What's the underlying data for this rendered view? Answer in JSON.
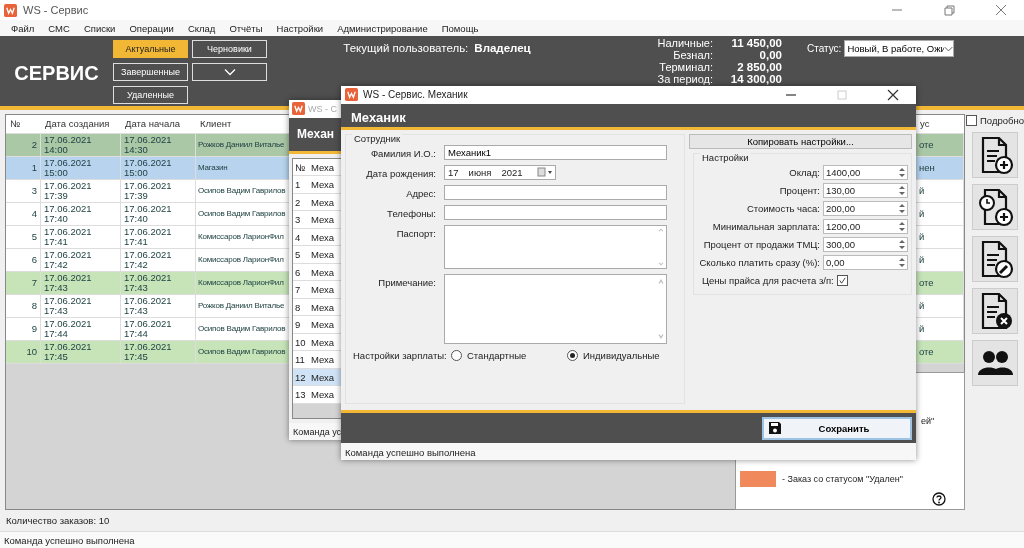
{
  "window": {
    "title": "WS - Сервис"
  },
  "menu": [
    "Файл",
    "СМС",
    "Списки",
    "Операции",
    "Склад",
    "Отчёты",
    "Настройки",
    "Администрирование",
    "Помощь"
  ],
  "header": {
    "title": "СЕРВИС",
    "filters": [
      {
        "kind": "button",
        "label": "Актуальные",
        "selected": true
      },
      {
        "kind": "button",
        "label": "Черновики",
        "selected": false
      },
      {
        "kind": "button",
        "label": "Завершенные",
        "selected": false
      },
      {
        "kind": "dropdown",
        "selected": false
      },
      {
        "kind": "button",
        "label": "Удаленные",
        "selected": false
      }
    ],
    "user_label": "Текущий пользователь:",
    "user": "Владелец",
    "totals": [
      {
        "label": "Наличные:",
        "value": "11 450,00"
      },
      {
        "label": "Безнал:",
        "value": "0,00"
      },
      {
        "label": "Терминал:",
        "value": "2 850,00"
      },
      {
        "label": "За период:",
        "value": "14 300,00"
      }
    ],
    "status_filter": {
      "label": "Статус:",
      "value": "Новый, В работе, Ожи"
    }
  },
  "orders": {
    "columns": [
      "№",
      "Дата создания",
      "Дата начала",
      "Клиент",
      "ус"
    ],
    "rows": [
      {
        "no": "2",
        "created_date": "17.06.2021",
        "created_time": "14:00",
        "start_date": "17.06.2021",
        "start_time": "14:30",
        "client": "Рожков Даниил Виталье",
        "status": "оте",
        "color": "#aac7a6"
      },
      {
        "no": "1",
        "created_date": "17.06.2021",
        "created_time": "15:00",
        "start_date": "17.06.2021",
        "start_time": "15:00",
        "client": "Магазин",
        "status": "нен",
        "color": "#b7d3ee"
      },
      {
        "no": "3",
        "created_date": "17.06.2021",
        "created_time": "17:39",
        "start_date": "17.06.2021",
        "start_time": "17:39",
        "client": "Осипов Вадим Гаврилов",
        "status": "й",
        "color": "#ffffff"
      },
      {
        "no": "4",
        "created_date": "17.06.2021",
        "created_time": "17:40",
        "start_date": "17.06.2021",
        "start_time": "17:40",
        "client": "Осипов Вадим Гаврилов",
        "status": "й",
        "color": "#ffffff"
      },
      {
        "no": "5",
        "created_date": "17.06.2021",
        "created_time": "17:41",
        "start_date": "17.06.2021",
        "start_time": "17:41",
        "client": "Комиссаров ЛарионФил",
        "status": "й",
        "color": "#ffffff"
      },
      {
        "no": "6",
        "created_date": "17.06.2021",
        "created_time": "17:42",
        "start_date": "17.06.2021",
        "start_time": "17:42",
        "client": "Комиссаров ЛарионФил",
        "status": "й",
        "color": "#ffffff"
      },
      {
        "no": "7",
        "created_date": "17.06.2021",
        "created_time": "17:43",
        "start_date": "17.06.2021",
        "start_time": "17:43",
        "client": "Комиссаров ЛарионФил",
        "status": "оте",
        "color": "#c6e4b8"
      },
      {
        "no": "8",
        "created_date": "17.06.2021",
        "created_time": "17:43",
        "start_date": "17.06.2021",
        "start_time": "17:43",
        "client": "Рожков Даниил Виталье",
        "status": "й",
        "color": "#ffffff"
      },
      {
        "no": "9",
        "created_date": "17.06.2021",
        "created_time": "17:44",
        "start_date": "17.06.2021",
        "start_time": "17:44",
        "client": "Осипов Вадим Гаврилов",
        "status": "й",
        "color": "#ffffff"
      },
      {
        "no": "10",
        "created_date": "17.06.2021",
        "created_time": "17:45",
        "start_date": "17.06.2021",
        "start_time": "17:45",
        "client": "Осипов Вадим Гаврилов",
        "status": "оте",
        "color": "#c6e4b8"
      }
    ]
  },
  "detail": {
    "label": "Подробно",
    "checked": false
  },
  "legend": [
    {
      "text": "ей\""
    },
    {
      "color": "#f08a5d",
      "text": "-  Заказ со статусом \"Удален\""
    }
  ],
  "order_count": "Количество заказов: 10",
  "status_bar": "Команда успешно выполнена",
  "back_dialog": {
    "title": "WS - С",
    "header": "Механ",
    "columns": [
      "№",
      "Меха"
    ],
    "rows": [
      {
        "no": "1",
        "name": "Меха",
        "selected": false
      },
      {
        "no": "2",
        "name": "Меха",
        "selected": false
      },
      {
        "no": "3",
        "name": "Меха",
        "selected": false
      },
      {
        "no": "4",
        "name": "Меха",
        "selected": false
      },
      {
        "no": "5",
        "name": "Меха",
        "selected": false
      },
      {
        "no": "6",
        "name": "Меха",
        "selected": false
      },
      {
        "no": "7",
        "name": "Меха",
        "selected": false
      },
      {
        "no": "8",
        "name": "Меха",
        "selected": false
      },
      {
        "no": "9",
        "name": "Меха",
        "selected": false
      },
      {
        "no": "10",
        "name": "Меха",
        "selected": false
      },
      {
        "no": "11",
        "name": "Меха",
        "selected": false
      },
      {
        "no": "12",
        "name": "Меха",
        "selected": true
      },
      {
        "no": "13",
        "name": "Меха",
        "selected": false
      }
    ],
    "status": "Команда ус"
  },
  "dialog": {
    "title": "WS - Сервис. Механик",
    "header": "Механик",
    "employee": {
      "legend": "Сотрудник",
      "fields": [
        {
          "kind": "text",
          "label": "Фамилия И.О.:",
          "value": "Механик1"
        },
        {
          "kind": "date",
          "label": "Дата рождения:",
          "day": "17",
          "month": "июня",
          "year": "2021"
        },
        {
          "kind": "text",
          "label": "Адрес:"
        },
        {
          "kind": "text",
          "label": "Телефоны:"
        },
        {
          "kind": "memo",
          "label": "Паспорт:"
        },
        {
          "kind": "memo",
          "label": "Примечание:"
        }
      ],
      "salary_label": "Настройки зарплаты:",
      "salary_options": [
        {
          "label": "Стандартные",
          "selected": false
        },
        {
          "label": "Индивидуальные",
          "selected": true
        }
      ]
    },
    "copy_button": "Копировать настройки...",
    "settings": {
      "legend": "Настройки",
      "fields": [
        {
          "kind": "spin",
          "label": "Оклад:",
          "value": "1400,00"
        },
        {
          "kind": "spin",
          "label": "Процент:",
          "value": "130,00"
        },
        {
          "kind": "spin",
          "label": "Стоимость часа:",
          "value": "200,00"
        },
        {
          "kind": "spin",
          "label": "Минимальная зарплата:",
          "value": "1200,00"
        },
        {
          "kind": "spin",
          "label": "Процент от продажи ТМЦ:",
          "value": "300,00"
        },
        {
          "kind": "spin",
          "label": "Сколько платить сразу (%):",
          "value": "0,00"
        },
        {
          "kind": "check",
          "label": "Цены прайса для расчета з/п:",
          "checked": true
        }
      ]
    },
    "save_button": "Сохранить",
    "status": "Команда успешно выполнена"
  }
}
